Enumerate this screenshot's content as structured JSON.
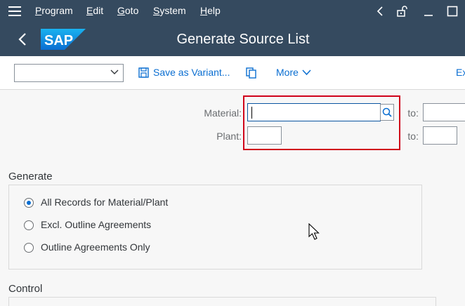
{
  "menubar": {
    "items": [
      {
        "label": "Program",
        "mnemonic": "P",
        "rest": "rogram"
      },
      {
        "label": "Edit",
        "mnemonic": "E",
        "rest": "dit"
      },
      {
        "label": "Goto",
        "mnemonic": "G",
        "rest": "oto"
      },
      {
        "label": "System",
        "mnemonic": "S",
        "rest": "ystem"
      },
      {
        "label": "Help",
        "mnemonic": "H",
        "rest": "elp"
      }
    ]
  },
  "titlebar": {
    "logo_text": "SAP",
    "title": "Generate Source List"
  },
  "toolbar": {
    "variant_value": "",
    "save_variant_label": "Save as Variant...",
    "more_label": "More",
    "exit_label": "Ex"
  },
  "selection": {
    "material_label": "Material:",
    "plant_label": "Plant:",
    "to_label": "to:",
    "material_from": "",
    "material_to": "",
    "plant_from": "",
    "plant_to": ""
  },
  "generate": {
    "title": "Generate",
    "options": [
      {
        "label": "All Records for Material/Plant",
        "checked": true
      },
      {
        "label": "Excl. Outline Agreements",
        "checked": false
      },
      {
        "label": "Outline Agreements Only",
        "checked": false
      }
    ]
  },
  "control": {
    "title": "Control"
  },
  "colors": {
    "shell": "#354a5f",
    "accent": "#0a6ed1",
    "highlight": "#d0021b"
  }
}
